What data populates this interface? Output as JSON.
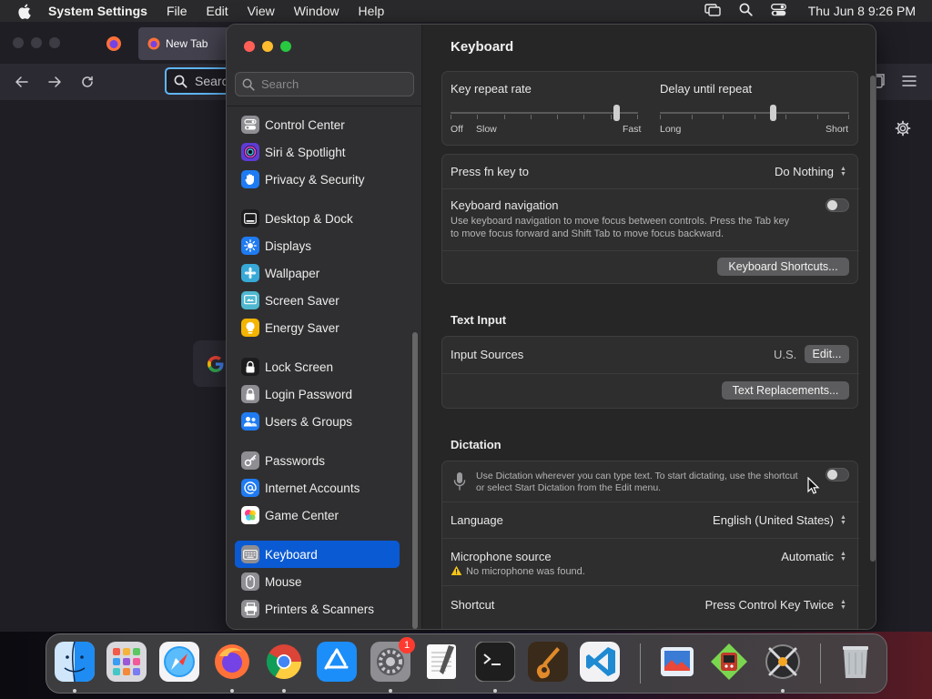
{
  "menubar": {
    "app_name": "System Settings",
    "items": [
      "File",
      "Edit",
      "View",
      "Window",
      "Help"
    ],
    "clock": "Thu Jun 8  9:26 PM"
  },
  "browser": {
    "tab_title": "New Tab",
    "url_placeholder": "Searc"
  },
  "sidebar": {
    "search_placeholder": "Search",
    "items": [
      {
        "label": "Control Center",
        "icon": "control-center-icon",
        "color": "#8e8e93"
      },
      {
        "label": "Siri & Spotlight",
        "icon": "siri-icon",
        "color": "#5e3bd6"
      },
      {
        "label": "Privacy & Security",
        "icon": "hand-icon",
        "color": "#1f7bf2"
      },
      {
        "label": "Desktop & Dock",
        "icon": "desktop-dock-icon",
        "color": "#1c1c1e"
      },
      {
        "label": "Displays",
        "icon": "displays-icon",
        "color": "#1f7bf2"
      },
      {
        "label": "Wallpaper",
        "icon": "wallpaper-icon",
        "color": "#38a9d6"
      },
      {
        "label": "Screen Saver",
        "icon": "screen-saver-icon",
        "color": "#4fb8d0"
      },
      {
        "label": "Energy Saver",
        "icon": "lightbulb-icon",
        "color": "#f4b400"
      },
      {
        "label": "Lock Screen",
        "icon": "lock-screen-icon",
        "color": "#1c1c1e"
      },
      {
        "label": "Login Password",
        "icon": "login-lock-icon",
        "color": "#8e8e93"
      },
      {
        "label": "Users & Groups",
        "icon": "users-icon",
        "color": "#1f7bf2"
      },
      {
        "label": "Passwords",
        "icon": "key-icon",
        "color": "#8e8e93"
      },
      {
        "label": "Internet Accounts",
        "icon": "at-icon",
        "color": "#1f7bf2"
      },
      {
        "label": "Game Center",
        "icon": "game-center-icon",
        "color": "#ffffff"
      },
      {
        "label": "Keyboard",
        "icon": "keyboard-icon",
        "color": "#8e8e93",
        "selected": true
      },
      {
        "label": "Mouse",
        "icon": "mouse-icon",
        "color": "#8e8e93"
      },
      {
        "label": "Printers & Scanners",
        "icon": "printer-icon",
        "color": "#8e8e93"
      }
    ]
  },
  "main": {
    "title": "Keyboard",
    "key_repeat": {
      "label": "Key repeat rate",
      "caps": [
        "Off",
        "Slow",
        "Fast"
      ],
      "value": 0.9
    },
    "delay_repeat": {
      "label": "Delay until repeat",
      "caps": [
        "Long",
        "Short"
      ],
      "value": 0.6
    },
    "fn_key": {
      "label": "Press fn key to",
      "value": "Do Nothing"
    },
    "keyboard_nav": {
      "label": "Keyboard navigation",
      "description_line1": "Use keyboard navigation to move focus between controls. Press the Tab key",
      "description_line2": "to move focus forward and Shift Tab to move focus backward.",
      "enabled": false
    },
    "shortcuts_button": "Keyboard Shortcuts...",
    "text_input": {
      "section_title": "Text Input",
      "input_sources_label": "Input Sources",
      "input_sources_value": "U.S.",
      "edit_button": "Edit...",
      "replacements_button": "Text Replacements..."
    },
    "dictation": {
      "section_title": "Dictation",
      "description_line1": "Use Dictation wherever you can type text. To start dictating, use the shortcut",
      "description_line2": "or select Start Dictation from the Edit menu.",
      "enabled": false,
      "language_label": "Language",
      "language_value": "English (United States)",
      "mic_label": "Microphone source",
      "mic_value": "Automatic",
      "mic_warning": "No microphone was found.",
      "shortcut_label": "Shortcut",
      "shortcut_value": "Press Control Key Twice"
    }
  },
  "dock": {
    "apps": [
      {
        "name": "finder-icon",
        "running": true
      },
      {
        "name": "launchpad-icon",
        "running": false
      },
      {
        "name": "safari-icon",
        "running": false
      },
      {
        "name": "firefox-icon",
        "running": true
      },
      {
        "name": "chrome-icon",
        "running": true
      },
      {
        "name": "app-store-icon",
        "running": false
      },
      {
        "name": "system-settings-icon",
        "running": true,
        "badge": "1"
      },
      {
        "name": "textedit-icon",
        "running": false
      },
      {
        "name": "terminal-icon",
        "running": true
      },
      {
        "name": "garageband-icon",
        "running": false
      },
      {
        "name": "vscode-icon",
        "running": false
      },
      {
        "name": "preview-icon",
        "running": false
      },
      {
        "name": "game-app-icon",
        "running": false
      },
      {
        "name": "xcode-tools-icon",
        "running": true
      },
      {
        "name": "trash-icon",
        "running": false
      }
    ]
  }
}
